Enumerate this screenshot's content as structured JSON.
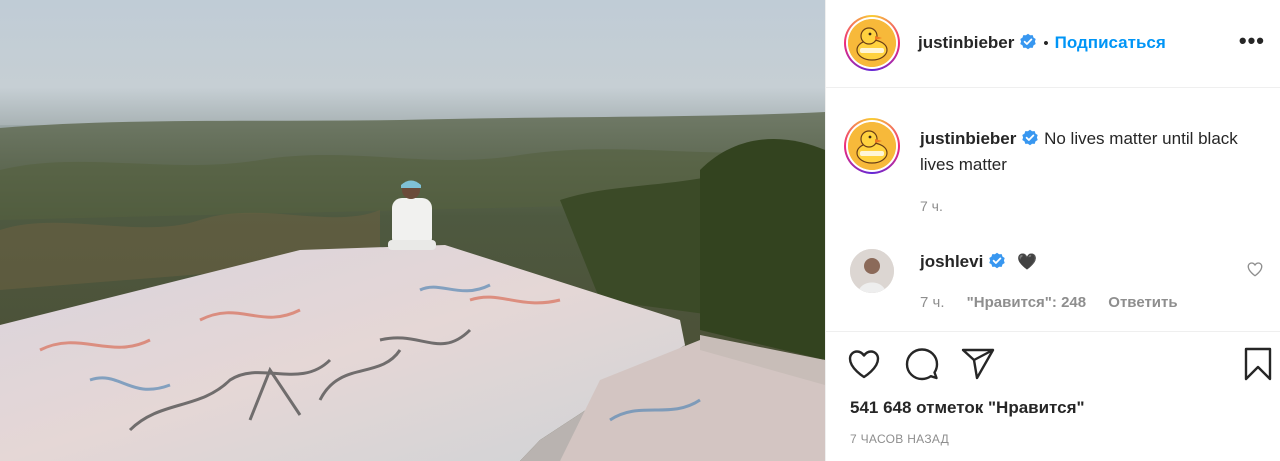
{
  "post": {
    "photo_alt": "",
    "author": {
      "username": "justinbieber",
      "verified": true,
      "follow_label": "Подписаться",
      "separator": "•",
      "more_label": "•••",
      "avatar_icon": "duck-avatar"
    },
    "caption": {
      "username": "justinbieber",
      "text": "No lives matter until black lives matter",
      "time": "7 ч."
    },
    "comments": [
      {
        "username": "joshlevi",
        "verified": true,
        "emoji": "🖤",
        "time": "7 ч.",
        "likes_label": "\"Нравится\": 248",
        "reply_label": "Ответить",
        "like_icon": "heart-outline-icon"
      }
    ],
    "actions": {
      "like_icon": "heart-outline-icon",
      "comment_icon": "comment-bubble-icon",
      "share_icon": "paper-plane-icon",
      "save_icon": "bookmark-icon"
    },
    "likes_text": "541 648 отметок \"Нравится\"",
    "date_text": "7 ЧАСОВ НАЗАД"
  },
  "colors": {
    "link": "#0095f6",
    "verified": "#3897f0",
    "secondary_text": "#8e8e8e",
    "divider": "#efefef"
  }
}
